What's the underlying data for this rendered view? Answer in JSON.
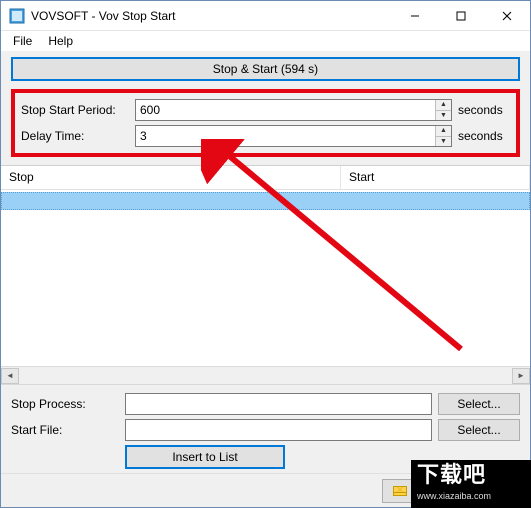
{
  "window": {
    "title": "VOVSOFT - Vov Stop Start"
  },
  "menu": {
    "file": "File",
    "help": "Help"
  },
  "main": {
    "stop_start_button": "Stop & Start (594 s)",
    "period_label": "Stop Start Period:",
    "period_value": "600",
    "period_unit": "seconds",
    "delay_label": "Delay Time:",
    "delay_value": "3",
    "delay_unit": "seconds"
  },
  "table": {
    "col_stop": "Stop",
    "col_start": "Start"
  },
  "bottom": {
    "stop_process_label": "Stop Process:",
    "stop_process_value": "",
    "start_file_label": "Start File:",
    "start_file_value": "",
    "select_label": "Select...",
    "insert_label": "Insert to List"
  },
  "feedback": {
    "label": "Send Feedback..."
  },
  "watermark": {
    "big": "下载吧",
    "small": "www.xiazaiba.com"
  }
}
